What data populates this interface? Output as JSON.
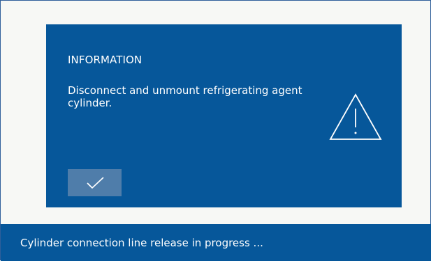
{
  "dialog": {
    "title": "INFORMATION",
    "message": "Disconnect and unmount refrigerating agent cylinder.",
    "icon": "warning-icon",
    "confirm_icon": "check-icon"
  },
  "status": {
    "text": "Cylinder connection line release in progress ..."
  },
  "colors": {
    "primary_blue": "#06579A",
    "button_blue": "#4F7DAA",
    "background": "#F7F8F5",
    "text": "#FFFFFF"
  }
}
